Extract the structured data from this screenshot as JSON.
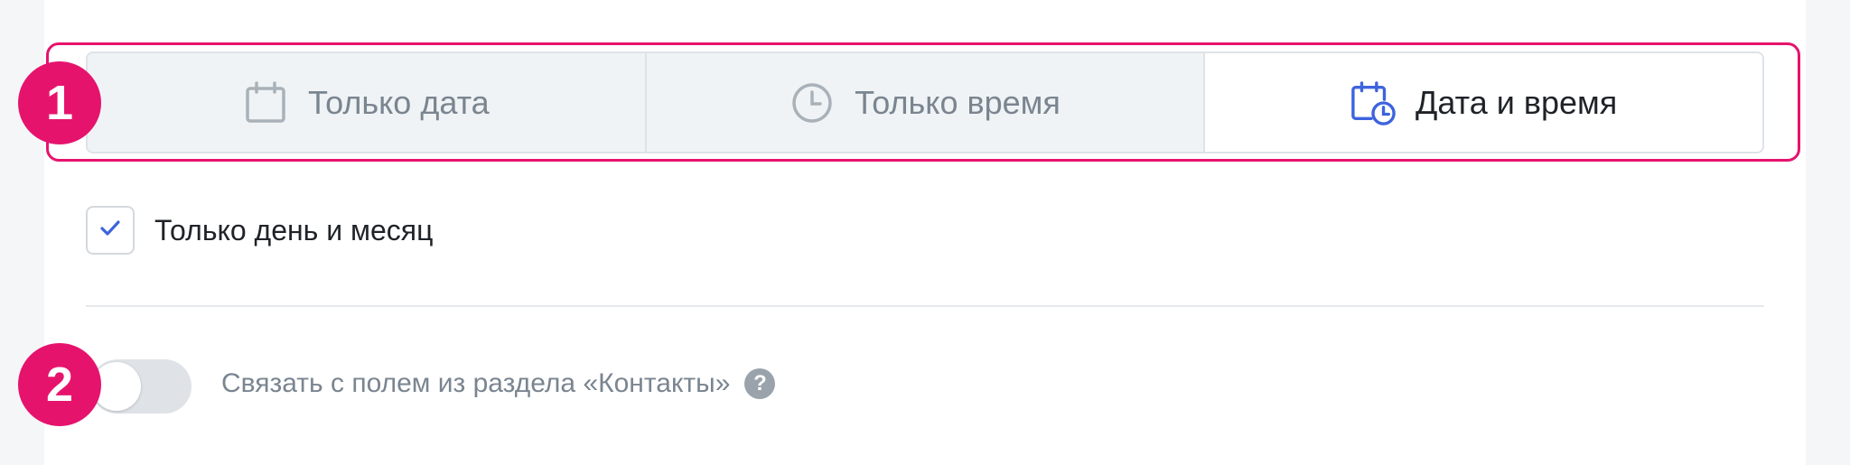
{
  "date_mode": {
    "options": [
      {
        "label": "Только дата",
        "icon": "calendar-icon",
        "active": false
      },
      {
        "label": "Только время",
        "icon": "clock-icon",
        "active": false
      },
      {
        "label": "Дата и время",
        "icon": "calendar-clock-icon",
        "active": true
      }
    ]
  },
  "day_month": {
    "checked": true,
    "label": "Только день и месяц"
  },
  "link_contacts": {
    "enabled": false,
    "label": "Связать с полем из раздела «Контакты»",
    "help_icon": "?"
  },
  "badges": {
    "first": "1",
    "second": "2"
  },
  "colors": {
    "accent": "#e6136d",
    "active_icon": "#3d63dd",
    "inactive": "#7a8590"
  }
}
